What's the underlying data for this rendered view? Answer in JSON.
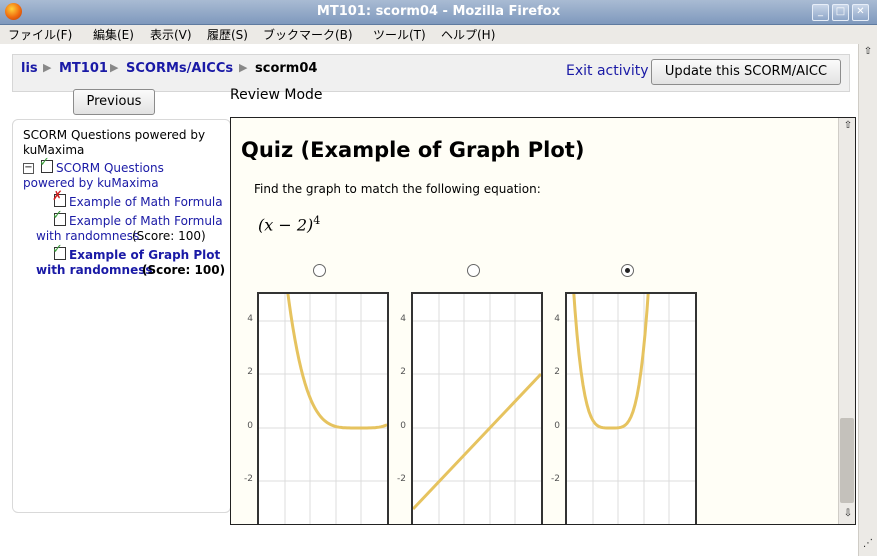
{
  "window": {
    "title": "MT101: scorm04 - Mozilla Firefox"
  },
  "menu": [
    "ファイル(F)",
    "編集(E)",
    "表示(V)",
    "履歴(S)",
    "ブックマーク(B)",
    "ツール(T)",
    "ヘルプ(H)"
  ],
  "breadcrumb": [
    "lis",
    "MT101",
    "SCORMs/AICCs",
    "scorm04"
  ],
  "nav": {
    "exit": "Exit activity",
    "update": "Update this SCORM/AICC"
  },
  "previous": "Previous",
  "review_mode": "Review Mode",
  "toc": {
    "header": "SCORM Questions powered by kuMaxima",
    "parent": {
      "line1": "SCORM Questions",
      "line2": "powered by kuMaxima"
    },
    "items": [
      {
        "line1": "Example of Math Formula",
        "status": "failed"
      },
      {
        "line1": "Example of Math Formula",
        "line2": "with randomness",
        "score": "(Score: 100)",
        "status": "passed"
      },
      {
        "line1": "Example of Graph Plot",
        "line2": "with randomness",
        "score": "(Score: 100)",
        "status": "passed",
        "current": true
      }
    ]
  },
  "quiz": {
    "title": "Quiz (Example of Graph Plot)",
    "prompt": "Find the graph to match the following equation:",
    "equation": "(x − 2)",
    "exponent": "4",
    "options": [
      {
        "selected": false,
        "yticks": [
          "4",
          "2",
          "0",
          "-2"
        ],
        "curve": "(x-2)^4 shifted"
      },
      {
        "selected": false,
        "yticks": [
          "4",
          "2",
          "0",
          "-2"
        ],
        "curve": "linear"
      },
      {
        "selected": true,
        "yticks": [
          "4",
          "2",
          "0",
          "-2"
        ],
        "curve": "(x-2)^4"
      }
    ],
    "curve_color": "#e6c35f"
  },
  "colors": {
    "link": "#1a1aa6",
    "check_green": "#3a9a3a",
    "fail_red": "#d02020"
  }
}
